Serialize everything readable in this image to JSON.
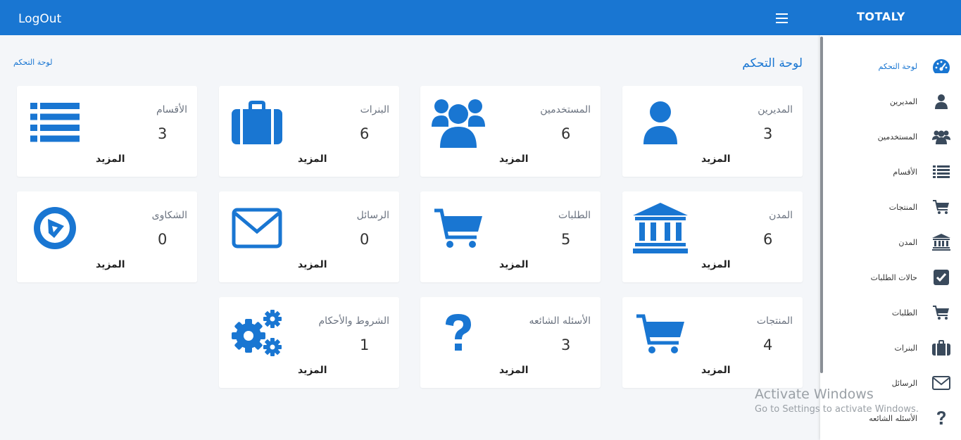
{
  "topbar": {
    "logout_label": "LogOut",
    "brand": "TOTALY"
  },
  "breadcrumb": {
    "current": "لوحة التحكم"
  },
  "page": {
    "title": "لوحة التحكم"
  },
  "sidebar": {
    "items": [
      {
        "label": "لوحة التحكم",
        "icon": "dashboard-icon"
      },
      {
        "label": "المديرين",
        "icon": "user-icon"
      },
      {
        "label": "المستخدمين",
        "icon": "users-icon"
      },
      {
        "label": "الأقسام",
        "icon": "list-icon"
      },
      {
        "label": "المنتجات",
        "icon": "cart-icon"
      },
      {
        "label": "المدن",
        "icon": "bank-icon"
      },
      {
        "label": "حالات الطلبات",
        "icon": "check-square-icon"
      },
      {
        "label": "الطلبات",
        "icon": "cart-icon"
      },
      {
        "label": "البنرات",
        "icon": "briefcase-icon"
      },
      {
        "label": "الرسائل",
        "icon": "envelope-icon"
      },
      {
        "label": "الأسئله الشائعه",
        "icon": "question-icon"
      }
    ]
  },
  "cards": [
    {
      "title": "المديرين",
      "count": "3",
      "more": "المزيد",
      "icon": "user-icon"
    },
    {
      "title": "المستخدمين",
      "count": "6",
      "more": "المزيد",
      "icon": "users-icon"
    },
    {
      "title": "البنرات",
      "count": "6",
      "more": "المزيد",
      "icon": "briefcase-icon"
    },
    {
      "title": "الأقسام",
      "count": "3",
      "more": "المزيد",
      "icon": "list-icon"
    },
    {
      "title": "المدن",
      "count": "6",
      "more": "المزيد",
      "icon": "bank-icon"
    },
    {
      "title": "الطلبات",
      "count": "5",
      "more": "المزيد",
      "icon": "cart-icon"
    },
    {
      "title": "الرسائل",
      "count": "0",
      "more": "المزيد",
      "icon": "envelope-icon"
    },
    {
      "title": "الشكاوى",
      "count": "0",
      "more": "المزيد",
      "icon": "play-circle-icon"
    },
    {
      "title": "المنتجات",
      "count": "4",
      "more": "المزيد",
      "icon": "cart-icon"
    },
    {
      "title": "الأسئله الشائعه",
      "count": "3",
      "more": "المزيد",
      "icon": "question-icon"
    },
    {
      "title": "الشروط والأحكام",
      "count": "1",
      "more": "المزيد",
      "icon": "gears-icon"
    }
  ],
  "watermark": {
    "title": "Activate Windows",
    "subtitle": "Go to Settings to activate Windows."
  },
  "colors": {
    "topbar": "#1976d2",
    "accent": "#1976d2",
    "sidebar_icon": "#3a4a5c",
    "background": "#f4f6f9"
  }
}
